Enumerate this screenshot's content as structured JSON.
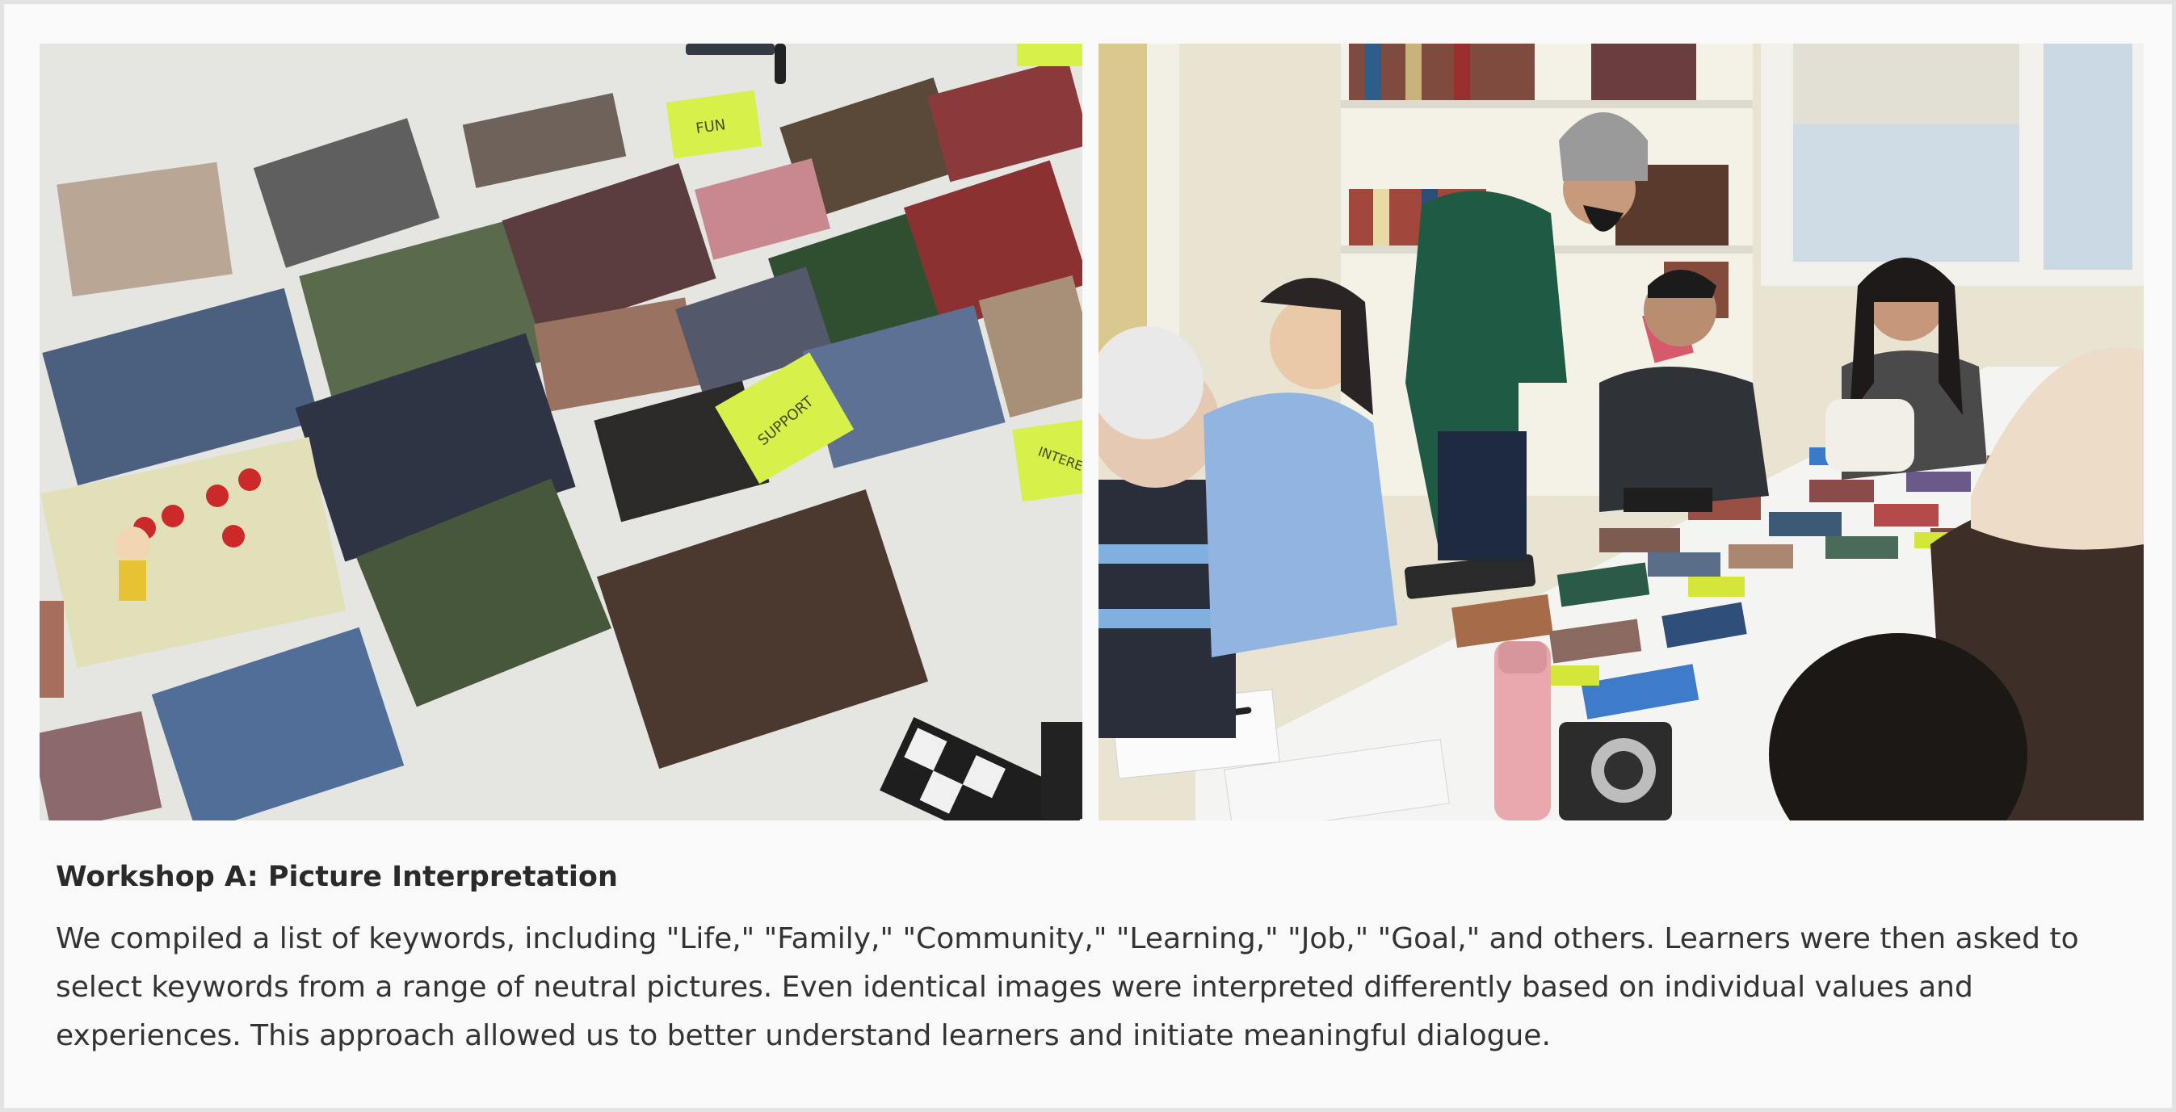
{
  "images": {
    "left": {
      "alt": "",
      "icon": "photo-icon"
    },
    "right": {
      "alt": "",
      "icon": "photo-icon"
    }
  },
  "sticky_notes": [
    "FUN",
    "SUPPORT",
    "INTERE"
  ],
  "caption": {
    "title": "Workshop A: Picture Interpretation",
    "body": "We compiled a list of keywords, including \"Life,\" \"Family,\" \"Community,\" \"Learning,\" \"Job,\" \"Goal,\" and others. Learners were then asked to select keywords from a range of neutral pictures. Even identical images were interpreted differently based on individual values and experiences. This approach allowed us to better understand learners and initiate meaningful dialogue."
  },
  "colors": {
    "page_border": "#e3e3e3",
    "card_background": "#f9f9f9",
    "title_text": "#2a2a2a",
    "body_text": "#333333",
    "sticky_note": "#d7f04a"
  }
}
